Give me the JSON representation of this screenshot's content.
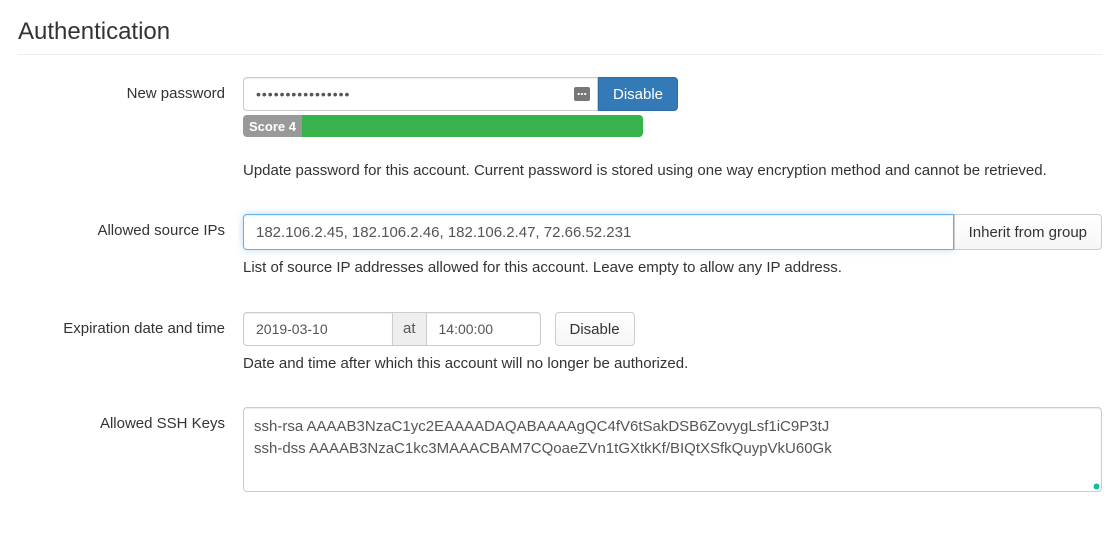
{
  "section_title": "Authentication",
  "labels": {
    "new_password": "New password",
    "allowed_ips": "Allowed source IPs",
    "expiration": "Expiration date and time",
    "ssh_keys": "Allowed SSH Keys"
  },
  "password": {
    "value": "••••••••••••••••",
    "disable_button": "Disable",
    "score_label": "Score 4",
    "help": "Update password for this account. Current password is stored using one way encryption method and cannot be retrieved."
  },
  "allowed_ips": {
    "value": "182.106.2.45, 182.106.2.46, 182.106.2.47, 72.66.52.231",
    "inherit_button": "Inherit from group",
    "help": "List of source IP addresses allowed for this account. Leave empty to allow any IP address."
  },
  "expiration": {
    "date": "2019-03-10",
    "at": "at",
    "time": "14:00:00",
    "disable_button": "Disable",
    "help": "Date and time after which this account will no longer be authorized."
  },
  "ssh": {
    "value": "ssh-rsa AAAAB3NzaC1yc2EAAAADAQABAAAAgQC4fV6tSakDSB6ZovygLsf1iC9P3tJ\nssh-dss AAAAB3NzaC1kc3MAAACBAM7CQoaeZVn1tGXtkKf/BIQtXSfkQuypVkU60Gk"
  }
}
